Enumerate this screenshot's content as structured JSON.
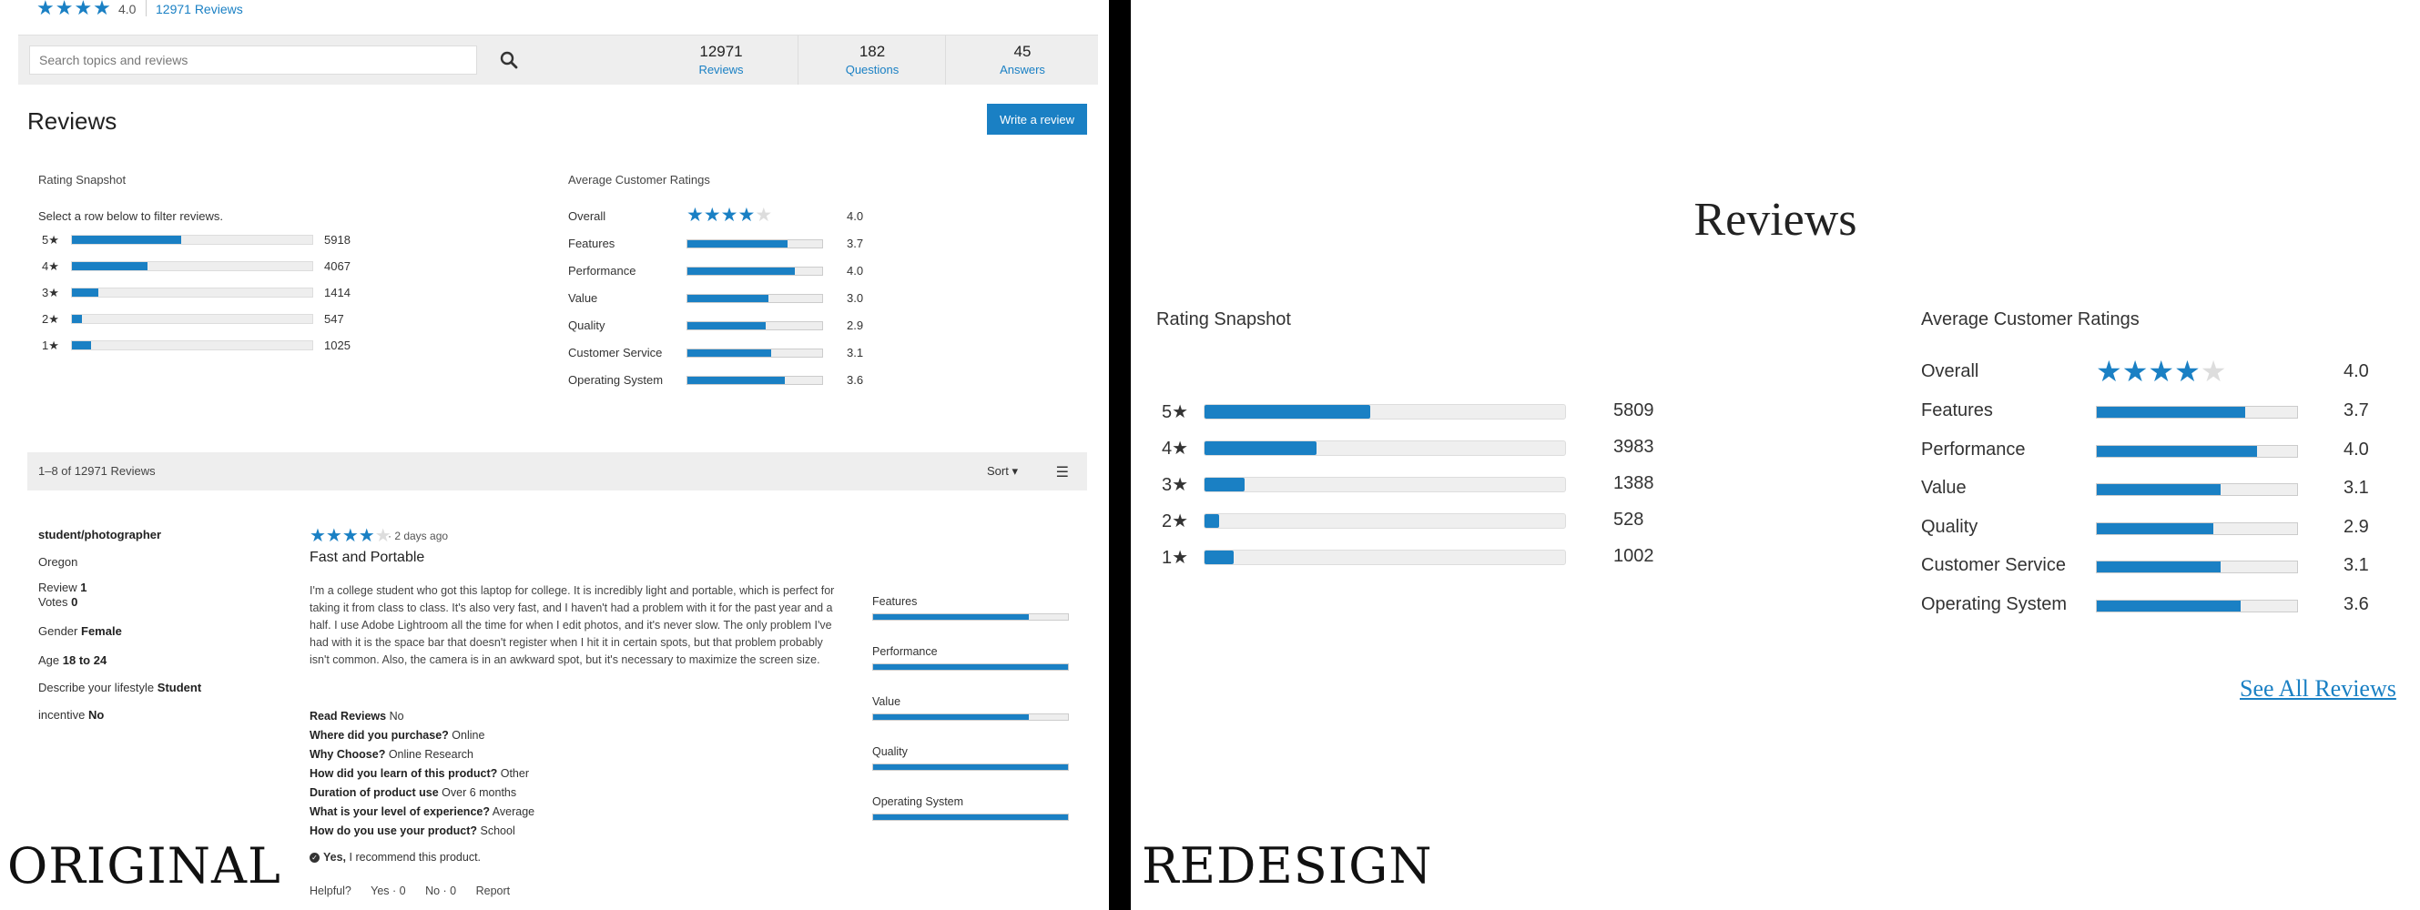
{
  "original": {
    "summary": {
      "stars": "★★★★",
      "score": "4.0",
      "review_count_link": "12971 Reviews"
    },
    "search": {
      "placeholder": "Search topics and reviews"
    },
    "stats": [
      {
        "value": "12971",
        "label": "Reviews"
      },
      {
        "value": "182",
        "label": "Questions"
      },
      {
        "value": "45",
        "label": "Answers"
      }
    ],
    "heading": "Reviews",
    "write_review_label": "Write a review",
    "snapshot": {
      "title": "Rating Snapshot",
      "hint": "Select a row below to filter reviews.",
      "rows": [
        {
          "label": "5★",
          "count": "5918",
          "fraction": 0.456
        },
        {
          "label": "4★",
          "count": "4067",
          "fraction": 0.314
        },
        {
          "label": "3★",
          "count": "1414",
          "fraction": 0.109
        },
        {
          "label": "2★",
          "count": "547",
          "fraction": 0.042
        },
        {
          "label": "1★",
          "count": "1025",
          "fraction": 0.079
        }
      ]
    },
    "averages": {
      "title": "Average Customer Ratings",
      "overall": {
        "label": "Overall",
        "value": "4.0",
        "stars_filled": "★★★★",
        "stars_empty": "★"
      },
      "rows": [
        {
          "label": "Features",
          "value": "3.7",
          "fraction": 0.74
        },
        {
          "label": "Performance",
          "value": "4.0",
          "fraction": 0.8
        },
        {
          "label": "Value",
          "value": "3.0",
          "fraction": 0.6
        },
        {
          "label": "Quality",
          "value": "2.9",
          "fraction": 0.58
        },
        {
          "label": "Customer Service",
          "value": "3.1",
          "fraction": 0.62
        },
        {
          "label": "Operating System",
          "value": "3.6",
          "fraction": 0.72
        }
      ]
    },
    "list_bar": {
      "count_text": "1–8 of 12971 Reviews",
      "sort_label": "Sort ▾",
      "menu_glyph": "☰"
    },
    "review": {
      "author": "student/photographer",
      "location": "Oregon",
      "meta": [
        {
          "key": "Review",
          "value": "1"
        },
        {
          "key": "Votes",
          "value": "0"
        },
        {
          "key": "Gender",
          "value": "Female"
        },
        {
          "key": "Age",
          "value": "18 to 24"
        },
        {
          "key": "Describe your lifestyle",
          "value": "Student"
        },
        {
          "key": "incentive",
          "value": "No"
        }
      ],
      "stars_filled": "★★★★",
      "stars_empty": "★",
      "date": "· 2 days ago",
      "title": "Fast and Portable",
      "body": "I'm a college student who got this laptop for college. It is incredibly light and portable, which is perfect for taking it from class to class. It's also very fast, and I haven't had a problem with it for the past year and a half. I use Adobe Lightroom all the time for when I edit photos, and it's never slow. The only problem I've had with it is the space bar that doesn't register when I hit it in certain spots, but that problem probably isn't common. Also, the camera is in an awkward spot, but it's necessary to maximize the screen size.",
      "qa": [
        {
          "q": "Read Reviews",
          "a": "No"
        },
        {
          "q": "Where did you purchase?",
          "a": "Online"
        },
        {
          "q": "Why Choose?",
          "a": "Online Research"
        },
        {
          "q": "How did you learn of this product?",
          "a": "Other"
        },
        {
          "q": "Duration of product use",
          "a": "Over 6 months"
        },
        {
          "q": "What is your level of experience?",
          "a": "Average"
        },
        {
          "q": "How do you use your product?",
          "a": "School"
        }
      ],
      "recommend_yes": "Yes,",
      "recommend_text": "I recommend this product.",
      "helpful": {
        "label": "Helpful?",
        "yes": "Yes · 0",
        "no": "No · 0",
        "report": "Report"
      },
      "sub_ratings": [
        {
          "label": "Features",
          "fraction": 0.8
        },
        {
          "label": "Performance",
          "fraction": 1.0
        },
        {
          "label": "Value",
          "fraction": 0.8
        },
        {
          "label": "Quality",
          "fraction": 1.0
        },
        {
          "label": "Operating System",
          "fraction": 1.0
        }
      ]
    },
    "corner_label": "ORIGINAL"
  },
  "redesign": {
    "heading": "Reviews",
    "snapshot": {
      "title": "Rating Snapshot",
      "rows": [
        {
          "label": "5★",
          "count": "5809",
          "fraction": 0.46
        },
        {
          "label": "4★",
          "count": "3983",
          "fraction": 0.31
        },
        {
          "label": "3★",
          "count": "1388",
          "fraction": 0.11
        },
        {
          "label": "2★",
          "count": "528",
          "fraction": 0.04
        },
        {
          "label": "1★",
          "count": "1002",
          "fraction": 0.08
        }
      ]
    },
    "averages": {
      "title": "Average Customer Ratings",
      "overall": {
        "label": "Overall",
        "value": "4.0",
        "stars_filled": "★★★★",
        "stars_empty": "★"
      },
      "rows": [
        {
          "label": "Features",
          "value": "3.7",
          "fraction": 0.74
        },
        {
          "label": "Performance",
          "value": "4.0",
          "fraction": 0.8
        },
        {
          "label": "Value",
          "value": "3.1",
          "fraction": 0.62
        },
        {
          "label": "Quality",
          "value": "2.9",
          "fraction": 0.58
        },
        {
          "label": "Customer Service",
          "value": "3.1",
          "fraction": 0.62
        },
        {
          "label": "Operating System",
          "value": "3.6",
          "fraction": 0.72
        }
      ]
    },
    "see_all": "See All Reviews",
    "corner_label": "REDESIGN"
  },
  "colors": {
    "accent": "#1a80c4",
    "track": "#eeeeee",
    "divider": "#000000"
  }
}
